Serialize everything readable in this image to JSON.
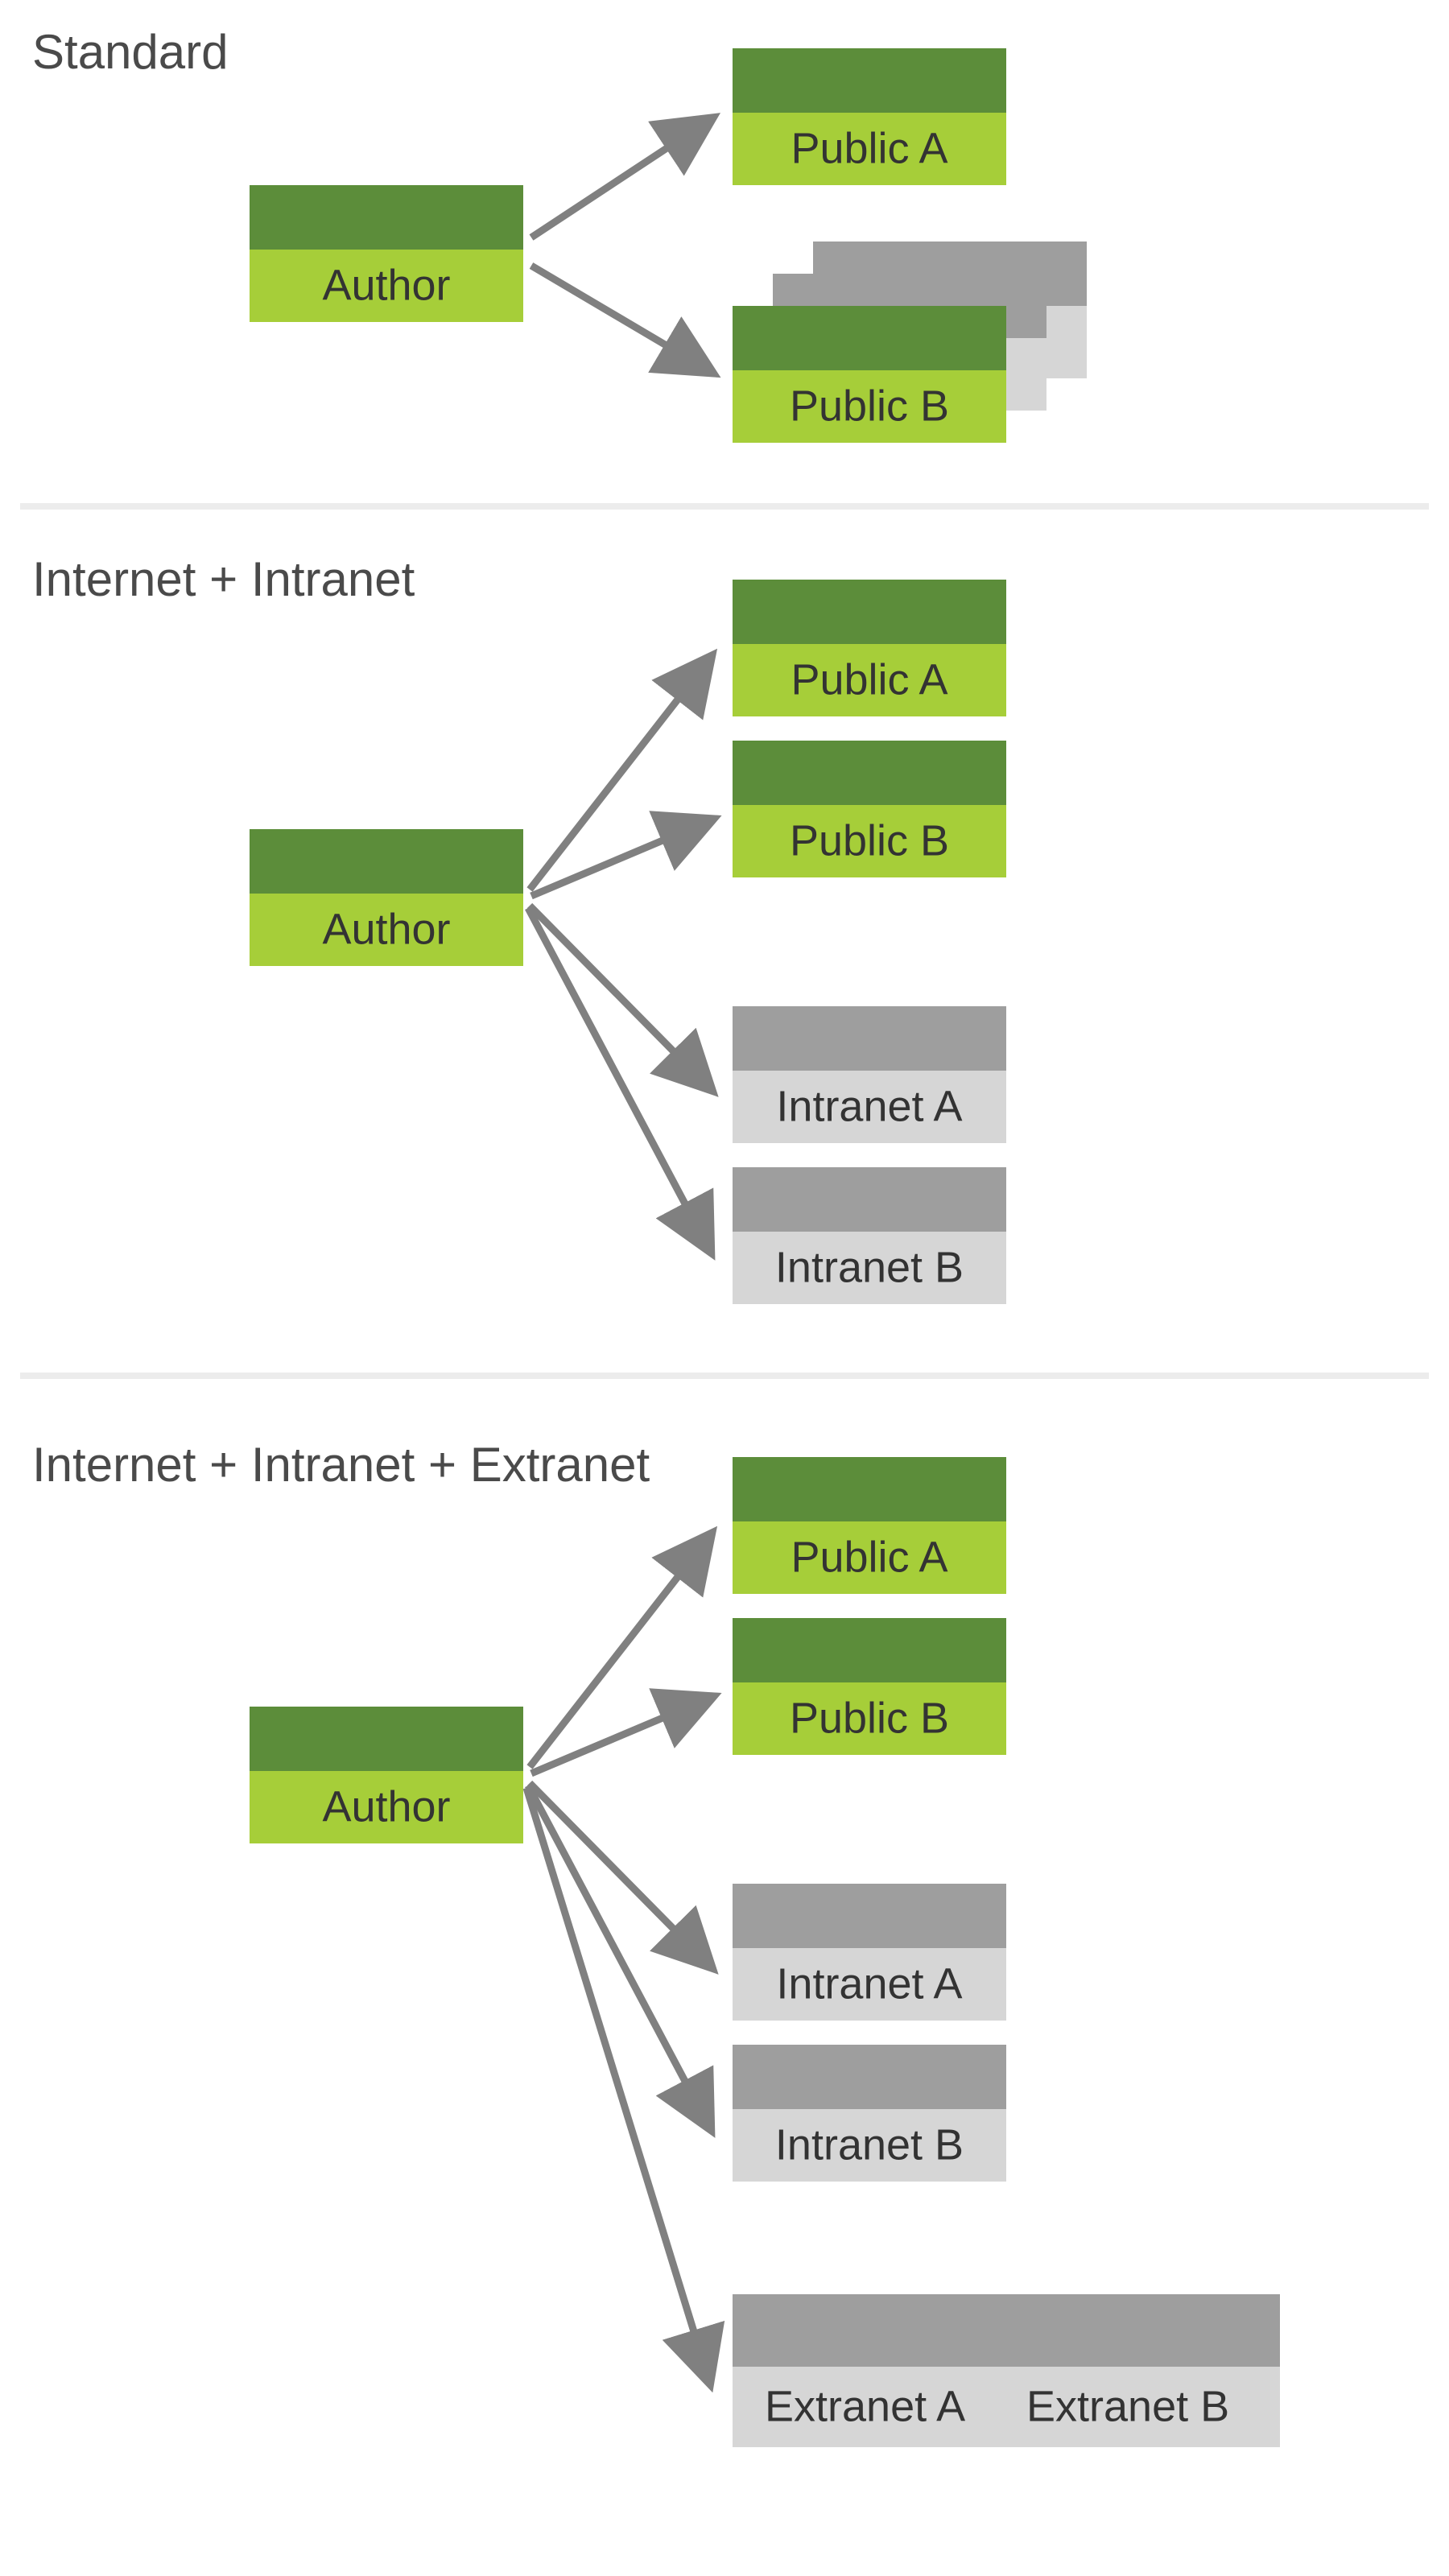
{
  "colors": {
    "green_dark": "#5c8d3a",
    "green_light": "#a6ce39",
    "grey_dark": "#9e9e9e",
    "grey_light": "#d6d6d6",
    "arrow": "#808080",
    "divider": "#ececec",
    "heading": "#4a4a4a",
    "text": "#333333"
  },
  "sections": {
    "standard": {
      "title": "Standard",
      "author": "Author",
      "targets": [
        "Public A",
        "Public B"
      ]
    },
    "internet_intranet": {
      "title": "Internet + Intranet",
      "author": "Author",
      "targets_public": [
        "Public A",
        "Public B"
      ],
      "targets_intranet": [
        "Intranet A",
        "Intranet B"
      ]
    },
    "internet_intranet_extranet": {
      "title": "Internet + Intranet + Extranet",
      "author": "Author",
      "targets_public": [
        "Public A",
        "Public B"
      ],
      "targets_intranet": [
        "Intranet A",
        "Intranet B"
      ],
      "targets_extranet": [
        "Extranet A",
        "Extranet B"
      ]
    }
  }
}
